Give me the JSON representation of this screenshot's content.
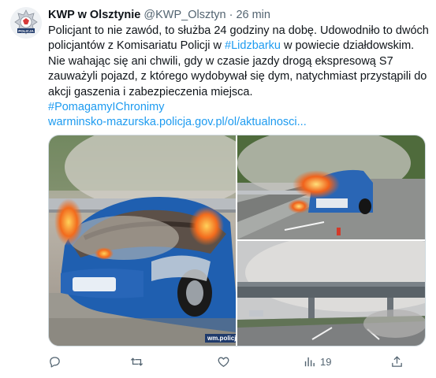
{
  "author": {
    "name": "KWP w Olsztynie",
    "handle": "@KWP_Olsztyn",
    "time": "· 26 min",
    "avatar_text": "POLICJA"
  },
  "tweet": {
    "line1": "Policjant to nie zawód, to służba 24 godziny na dobę. Udowodniło to dwóch",
    "line2_a": "policjantów z Komisariatu Policji w ",
    "line2_hashtag": "#Lidzbarku",
    "line2_b": " w powiecie działdowskim.",
    "line3": "Nie wahając się ani chwili, gdy w czasie jazdy drogą ekspresową S7",
    "line4": "zauważyli pojazd, z którego wydobywał się dym,  natychmiast przystąpili do",
    "line5": "akcji gaszenia i zabezpieczenia miejsca.",
    "hashtag": "#PomagamyIChronimy",
    "url": "warminsko-mazurska.policja.gov.pl/ol/aktualnosci..."
  },
  "media": {
    "watermark": "wm.policj"
  },
  "actions": {
    "reply_icon": "reply-icon",
    "retweet_icon": "retweet-icon",
    "like_icon": "heart-icon",
    "views_icon": "views-icon",
    "views_count": "19",
    "share_icon": "share-icon"
  },
  "colors": {
    "link": "#1d9bf0",
    "muted": "#536471",
    "text": "#0f1419"
  }
}
